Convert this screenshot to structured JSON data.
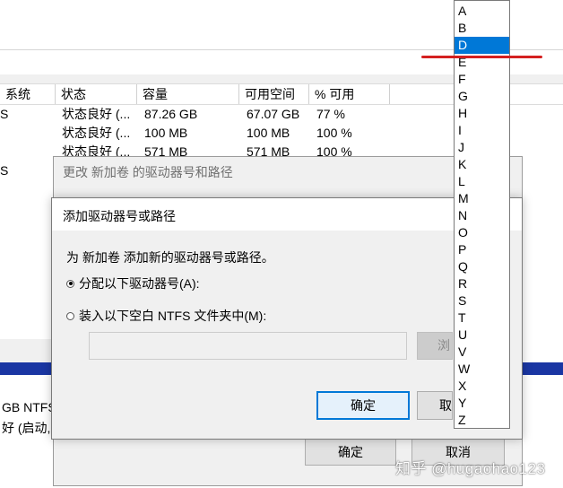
{
  "background_table": {
    "columns": [
      "系统",
      "状态",
      "容量",
      "可用空间",
      "% 可用"
    ],
    "rows": [
      {
        "fs": "S",
        "status": "状态良好 (...",
        "capacity": "87.26 GB",
        "free": "67.07 GB",
        "pct": "77 %"
      },
      {
        "fs": "",
        "status": "状态良好 (...",
        "capacity": "100 MB",
        "free": "100 MB",
        "pct": "100 %"
      },
      {
        "fs": "",
        "status": "状态良好 (...",
        "capacity": "571 MB",
        "free": "571 MB",
        "pct": "100 %"
      },
      {
        "fs": "S",
        "status": "",
        "capacity": "",
        "free": "",
        "pct": ""
      }
    ]
  },
  "background_volume": {
    "line1": "GB NTFS",
    "line2": "好 (启动, 页"
  },
  "outer_dialog": {
    "title": "更改 新加卷 的驱动器号和路径",
    "ok_label": "确定",
    "cancel_label": "取消"
  },
  "dialog": {
    "title": "添加驱动器号或路径",
    "description": "为 新加卷 添加新的驱动器号或路径。",
    "option_letter": "分配以下驱动器号(A):",
    "option_folder": "装入以下空白 NTFS 文件夹中(M):",
    "browse_label": "浏",
    "ok_label": "确定",
    "cancel_label": "取"
  },
  "drive_letters": [
    "A",
    "B",
    "D",
    "E",
    "F",
    "G",
    "H",
    "I",
    "J",
    "K",
    "L",
    "M",
    "N",
    "O",
    "P",
    "Q",
    "R",
    "S",
    "T",
    "U",
    "V",
    "W",
    "X",
    "Y",
    "Z"
  ],
  "selected_letter": "D",
  "watermark": "知乎 @hugaohao123",
  "colors": {
    "selection": "#0078d7",
    "highlight_line": "#d42020",
    "disk_bar": "#1a36a3"
  }
}
